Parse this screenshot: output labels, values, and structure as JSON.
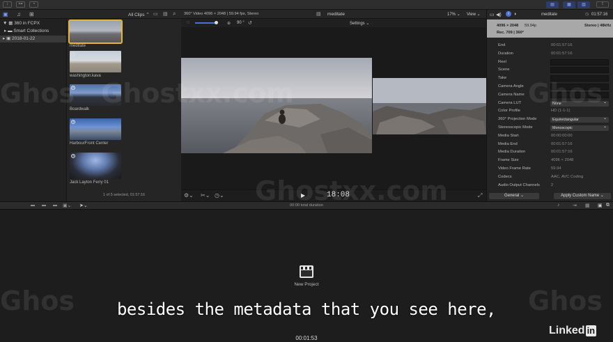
{
  "toolbar": {
    "layout_icons": [
      "libraries-layout-icon",
      "browser-layout-icon",
      "inspector-layout-icon"
    ]
  },
  "library": {
    "items": [
      {
        "label": "360 in FCPX",
        "kind": "library"
      },
      {
        "label": "Smart Collections",
        "kind": "folder"
      },
      {
        "label": "2018-01-22",
        "kind": "event",
        "selected": true
      }
    ]
  },
  "browser": {
    "filter_label": "All Clips",
    "clips": [
      {
        "label": "meditate",
        "selected": true
      },
      {
        "label": "washington.kava",
        "selected": false
      },
      {
        "label": "Boardwalk",
        "selected": false
      },
      {
        "label": "HarbourFront Center",
        "selected": false
      },
      {
        "label": "Jack Layton Ferry 01",
        "selected": false
      }
    ],
    "status": "1 of 5 selected, 01:57:16"
  },
  "viewer": {
    "format_info": "360° Video 4096 × 2048 | 59.94 fps, Stereo",
    "clip_name": "meditate",
    "zoom": "17%",
    "view_label": "View",
    "settings_label": "Settings",
    "angle": "90 °",
    "timecode": "18:08"
  },
  "inspector": {
    "clip_name": "meditate",
    "duration": "01:57:16",
    "format": "4096 × 2048",
    "fps": "59.94p",
    "audio": "Stereo | 48kHz",
    "color": "Rec. 709 | 360°",
    "rows": [
      {
        "key": "End",
        "value": "00:01:57:16",
        "type": "text"
      },
      {
        "key": "Duration",
        "value": "00:01:57:16",
        "type": "text"
      },
      {
        "key": "Reel",
        "value": "",
        "type": "field"
      },
      {
        "key": "Scene",
        "value": "",
        "type": "field"
      },
      {
        "key": "Take",
        "value": "",
        "type": "field"
      },
      {
        "key": "Camera Angle",
        "value": "",
        "type": "field"
      },
      {
        "key": "Camera Name",
        "value": "",
        "type": "field"
      },
      {
        "key": "Camera LUT",
        "value": "None",
        "type": "popup"
      },
      {
        "key": "Color Profile",
        "value": "HD (1-1-1)",
        "type": "text"
      },
      {
        "key": "360° Projection Mode",
        "value": "Equirectangular",
        "type": "popup"
      },
      {
        "key": "Stereoscopic Mode",
        "value": "Monoscopic",
        "type": "popup"
      },
      {
        "key": "Media Start",
        "value": "00:00:00:00",
        "type": "text"
      },
      {
        "key": "Media End",
        "value": "00:01:57:16",
        "type": "text"
      },
      {
        "key": "Media Duration",
        "value": "00:01:57:16",
        "type": "text"
      },
      {
        "key": "Frame Size",
        "value": "4096 × 2048",
        "type": "text"
      },
      {
        "key": "Video Frame Rate",
        "value": "59.94",
        "type": "text"
      },
      {
        "key": "Codecs",
        "value": "AAC, AVC Coding",
        "type": "text"
      },
      {
        "key": "Audio Output Channels",
        "value": "2",
        "type": "text"
      }
    ],
    "general_label": "General",
    "apply_label": "Apply Custom Name"
  },
  "timeline": {
    "total_duration": "00:00 total duration",
    "new_project_label": "New Project"
  },
  "subtitle": "besides the metadata that you see here,",
  "player_timecode": "00:01:53",
  "watermark": "Ghostxx.com",
  "watermark_short": "Ghos",
  "linkedin": {
    "text": "Linked",
    "in": "in"
  }
}
